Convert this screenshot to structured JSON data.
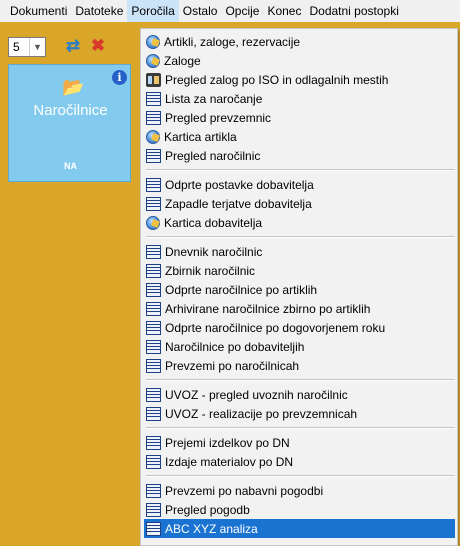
{
  "menubar": {
    "items": [
      "Dokumenti",
      "Datoteke",
      "Poročila",
      "Ostalo",
      "Opcije",
      "Konec",
      "Dodatni postopki"
    ],
    "open_index": 2
  },
  "toolbar": {
    "quantity_value": "5"
  },
  "tile": {
    "title": "Naročilnice",
    "code": "NA"
  },
  "menu": {
    "groups": [
      [
        {
          "label": "Artikli, zaloge, rezervacije",
          "icon": "globe-icon"
        },
        {
          "label": "Zaloge",
          "icon": "globe-icon"
        },
        {
          "label": "Pregled zalog po ISO in odlagalnih mestih",
          "icon": "iso-icon"
        },
        {
          "label": "Lista za naročanje",
          "icon": "list-icon"
        },
        {
          "label": "Pregled prevzemnic",
          "icon": "list-icon"
        },
        {
          "label": "Kartica artikla",
          "icon": "globe-icon"
        },
        {
          "label": "Pregled naročilnic",
          "icon": "list-icon"
        }
      ],
      [
        {
          "label": "Odprte postavke dobavitelja",
          "icon": "list-icon"
        },
        {
          "label": "Zapadle terjatve dobavitelja",
          "icon": "list-icon"
        },
        {
          "label": "Kartica dobavitelja",
          "icon": "globe-icon"
        }
      ],
      [
        {
          "label": "Dnevnik naročilnic",
          "icon": "list-icon"
        },
        {
          "label": "Zbirnik naročilnic",
          "icon": "list-icon"
        },
        {
          "label": "Odprte naročilnice po artiklih",
          "icon": "list-icon"
        },
        {
          "label": "Arhivirane naročilnice zbirno po artiklih",
          "icon": "list-icon"
        },
        {
          "label": "Odprte naročilnice po dogovorjenem roku",
          "icon": "list-icon"
        },
        {
          "label": "Naročilnice po dobaviteljih",
          "icon": "list-icon"
        },
        {
          "label": "Prevzemi po naročilnicah",
          "icon": "list-icon"
        }
      ],
      [
        {
          "label": "UVOZ - pregled uvoznih naročilnic",
          "icon": "list-icon"
        },
        {
          "label": "UVOZ - realizacije po prevzemnicah",
          "icon": "list-icon"
        }
      ],
      [
        {
          "label": "Prejemi izdelkov po DN",
          "icon": "list-icon"
        },
        {
          "label": "Izdaje materialov po DN",
          "icon": "list-icon"
        }
      ],
      [
        {
          "label": "Prevzemi po nabavni pogodbi",
          "icon": "list-icon"
        },
        {
          "label": "Pregled pogodb",
          "icon": "list-icon"
        },
        {
          "label": "ABC XYZ analiza",
          "icon": "list-icon",
          "highlighted": true
        }
      ]
    ]
  },
  "colors": {
    "workspace": "#d9a629",
    "tile": "#82cbee",
    "highlight": "#1a73d1",
    "menu_background": "#f2f2f2"
  }
}
